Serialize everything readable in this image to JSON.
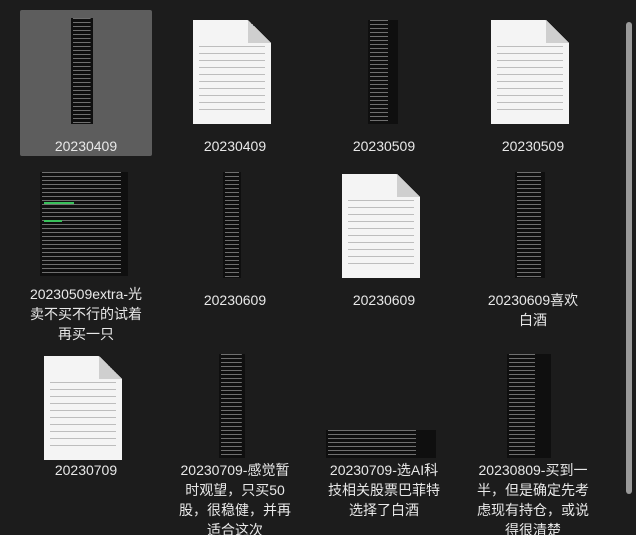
{
  "files": [
    {
      "name": "20230409",
      "kind": "screenshot",
      "selected": true
    },
    {
      "name": "20230409",
      "kind": "document"
    },
    {
      "name": "20230509",
      "kind": "screenshot"
    },
    {
      "name": "20230509",
      "kind": "document"
    },
    {
      "name": "20230509extra-光卖不买不行的试着再买一只",
      "kind": "screenshot"
    },
    {
      "name": "20230609",
      "kind": "screenshot"
    },
    {
      "name": "20230609",
      "kind": "document"
    },
    {
      "name": "20230609喜欢白酒",
      "kind": "screenshot"
    },
    {
      "name": "20230709",
      "kind": "document"
    },
    {
      "name": "20230709-感觉暂时观望，只买50股，很稳健，并再适合这次",
      "kind": "screenshot"
    },
    {
      "name": "20230709-选AI科技相关股票巴菲特选择了白酒",
      "kind": "screenshot"
    },
    {
      "name": "20230809-买到一半，但是确定先考虑现有持仓，或说得很清楚",
      "kind": "screenshot"
    }
  ],
  "icons": {
    "document": "document-icon",
    "screenshot": "image-thumbnail"
  },
  "colors": {
    "background": "#1c1c1c",
    "selection": "#5d5d5d",
    "text": "#e8e8e8"
  }
}
